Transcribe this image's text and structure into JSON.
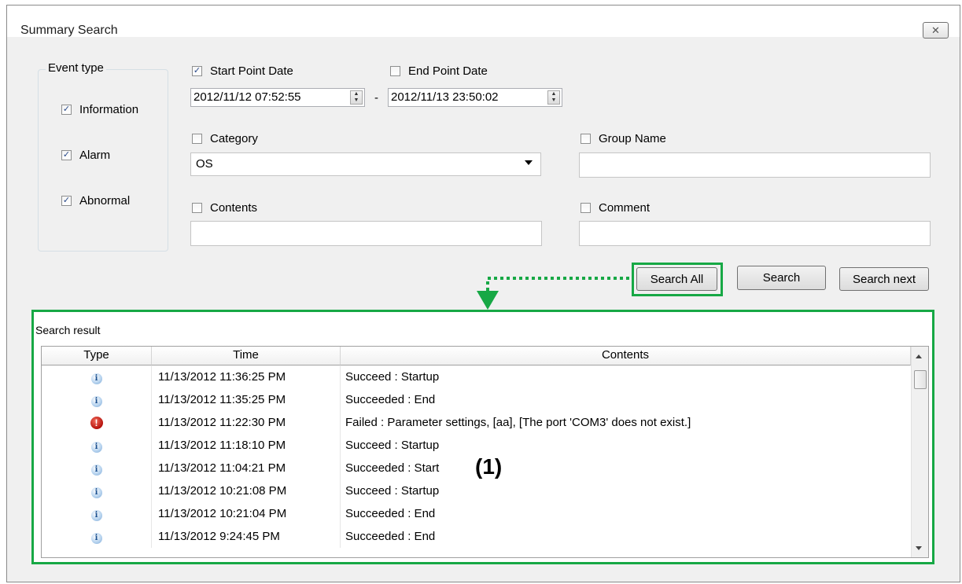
{
  "window": {
    "title": "Summary Search",
    "close_icon": "close-icon",
    "close_glyph": "✕"
  },
  "event_type": {
    "legend": "Event type",
    "items": [
      {
        "label": "Information",
        "checked": true
      },
      {
        "label": "Alarm",
        "checked": true
      },
      {
        "label": "Abnormal",
        "checked": true
      }
    ]
  },
  "date_range": {
    "start_label": "Start Point Date",
    "start_checked": true,
    "start_value": "2012/11/12 07:52:55",
    "separator": "-",
    "end_label": "End Point Date",
    "end_checked": false,
    "end_value": "2012/11/13 23:50:02"
  },
  "filters": {
    "category_label": "Category",
    "category_value": "OS",
    "group_name_label": "Group Name",
    "contents_label": "Contents",
    "comment_label": "Comment"
  },
  "buttons": {
    "search_all": "Search All",
    "search": "Search",
    "search_next": "Search next"
  },
  "results": {
    "label": "Search result",
    "columns": [
      "Type",
      "Time",
      "Contents"
    ],
    "rows": [
      {
        "type": "info",
        "time": "11/13/2012 11:36:25 PM",
        "contents": "Succeed : Startup"
      },
      {
        "type": "info",
        "time": "11/13/2012 11:35:25 PM",
        "contents": "Succeeded : End"
      },
      {
        "type": "error",
        "time": "11/13/2012 11:22:30 PM",
        "contents": "Failed : Parameter settings, [aa], [The port 'COM3' does not exist.]"
      },
      {
        "type": "info",
        "time": "11/13/2012 11:18:10 PM",
        "contents": "Succeed : Startup"
      },
      {
        "type": "info",
        "time": "11/13/2012 11:04:21 PM",
        "contents": "Succeeded : Start"
      },
      {
        "type": "info",
        "time": "11/13/2012 10:21:08 PM",
        "contents": "Succeed : Startup"
      },
      {
        "type": "info",
        "time": "11/13/2012 10:21:04 PM",
        "contents": "Succeeded : End"
      },
      {
        "type": "info",
        "time": "11/13/2012 9:24:45 PM",
        "contents": "Succeeded : End"
      }
    ]
  },
  "annotation": {
    "label": "(1)"
  },
  "colors": {
    "highlight": "#17a845",
    "window_bg": "#f0f0f0",
    "error_icon": "#b5120c",
    "info_icon": "#7aa7d6"
  }
}
